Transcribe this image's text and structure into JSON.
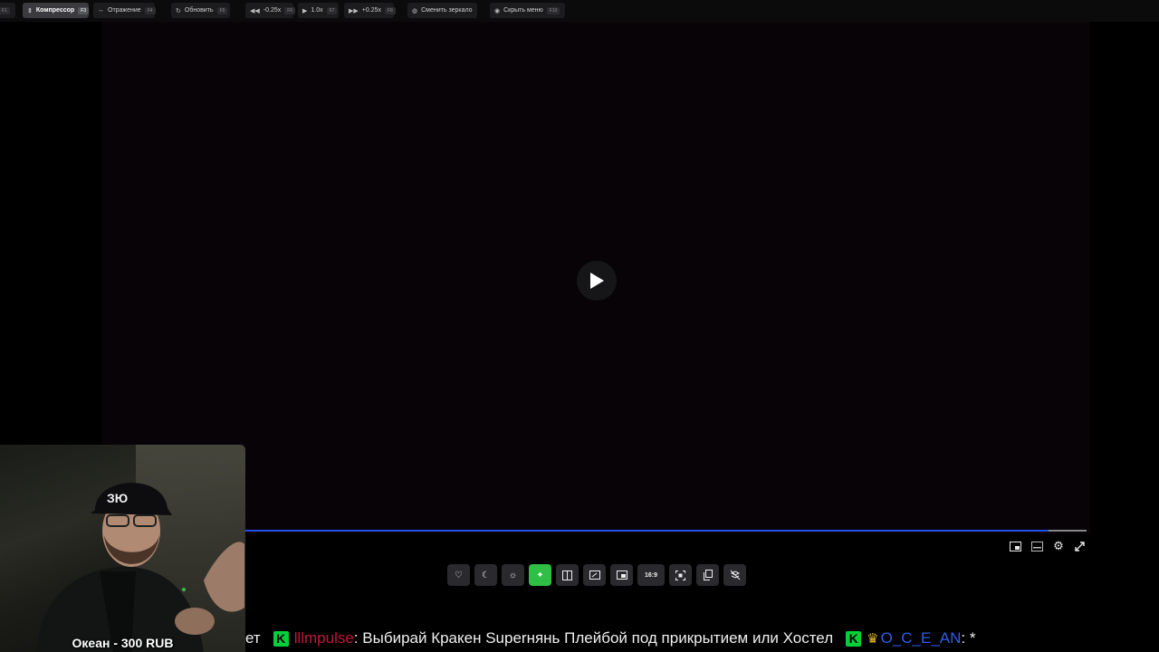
{
  "toolbar": {
    "buttons": [
      {
        "label": "",
        "key": "F1"
      },
      {
        "label": "Компрессор",
        "key": "F3",
        "icon": "compress-icon"
      },
      {
        "label": "Отражение",
        "key": "F4",
        "icon": "mirror-icon"
      },
      {
        "label": "Обновить",
        "key": "F5",
        "icon": "refresh-icon"
      },
      {
        "label": "-0.25x",
        "key": "F6",
        "icon": "rewind-icon"
      },
      {
        "label": "1.0x",
        "key": "F7",
        "icon": "play-icon"
      },
      {
        "label": "+0.25x",
        "key": "F8",
        "icon": "fast-forward-icon"
      },
      {
        "label": "Сменить зеркало",
        "key": "",
        "icon": "globe-icon"
      },
      {
        "label": "Скрыть меню",
        "key": "F10",
        "icon": "eye-icon"
      }
    ]
  },
  "player": {
    "progress_fraction": 0.955,
    "subtitle_ghost": "",
    "controls": [
      {
        "name": "favorite",
        "icon": "heart-icon"
      },
      {
        "name": "night-mode",
        "icon": "moon-icon"
      },
      {
        "name": "brightness",
        "icon": "sun-icon"
      },
      {
        "name": "enhance",
        "icon": "sparkle-icon"
      },
      {
        "name": "split-view",
        "icon": "columns-icon"
      },
      {
        "name": "resize",
        "icon": "resize-icon"
      },
      {
        "name": "picture-in-picture",
        "icon": "pip-icon"
      },
      {
        "name": "aspect-ratio",
        "label": "16:9"
      },
      {
        "name": "fit-screen",
        "icon": "focus-icon"
      },
      {
        "name": "copy",
        "icon": "copy-icon"
      },
      {
        "name": "layers-off",
        "icon": "layers-off-icon"
      }
    ]
  },
  "webcam": {
    "label": "Океан - 300 RUB"
  },
  "chat": {
    "fragment": "ет",
    "messages": [
      {
        "user": "lllmpulse",
        "text": ": Выбирай Кракен Superнянь Плейбой под прикрытием или Хостел"
      },
      {
        "user": "O_C_E_AN",
        "text": ": *"
      }
    ]
  }
}
